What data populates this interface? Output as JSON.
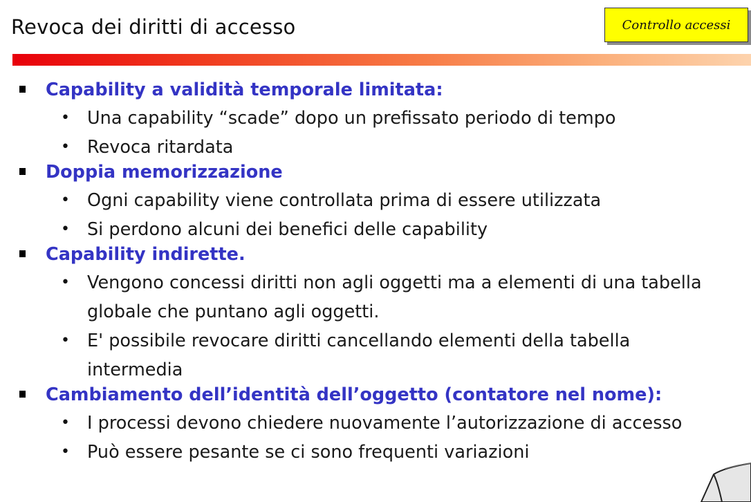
{
  "header": {
    "title": "Revoca dei diritti di accesso",
    "section_tag": "Controllo accessi"
  },
  "sections": [
    {
      "heading": "Capability a validità temporale limitata:",
      "items": [
        "Una capability “scade” dopo un prefissato periodo di tempo",
        "Revoca ritardata"
      ]
    },
    {
      "heading": "Doppia memorizzazione",
      "items": [
        "Ogni capability viene controllata prima di essere utilizzata",
        "Si perdono alcuni dei benefici delle capability"
      ]
    },
    {
      "heading": "Capability indirette.",
      "items": [
        "Vengono concessi diritti non agli oggetti ma a elementi di una tabella globale che puntano agli oggetti.",
        "E' possibile revocare diritti cancellando elementi della tabella intermedia"
      ]
    },
    {
      "heading": "Cambiamento dell’identità dell’oggetto (contatore nel nome):",
      "items": [
        "I processi devono chiedere nuovamente l’autorizzazione di accesso",
        "Può essere pesante se ci sono frequenti variazioni"
      ]
    }
  ],
  "colors": {
    "heading": "#3434c4",
    "tag_background": "#ffff00",
    "bar_start": "#e8000a",
    "bar_end": "#fdd3ad"
  },
  "icons": {
    "level1_bullet": "square-bullet-icon",
    "level2_bullet": "round-bullet-icon",
    "corner": "page-curl-icon"
  }
}
